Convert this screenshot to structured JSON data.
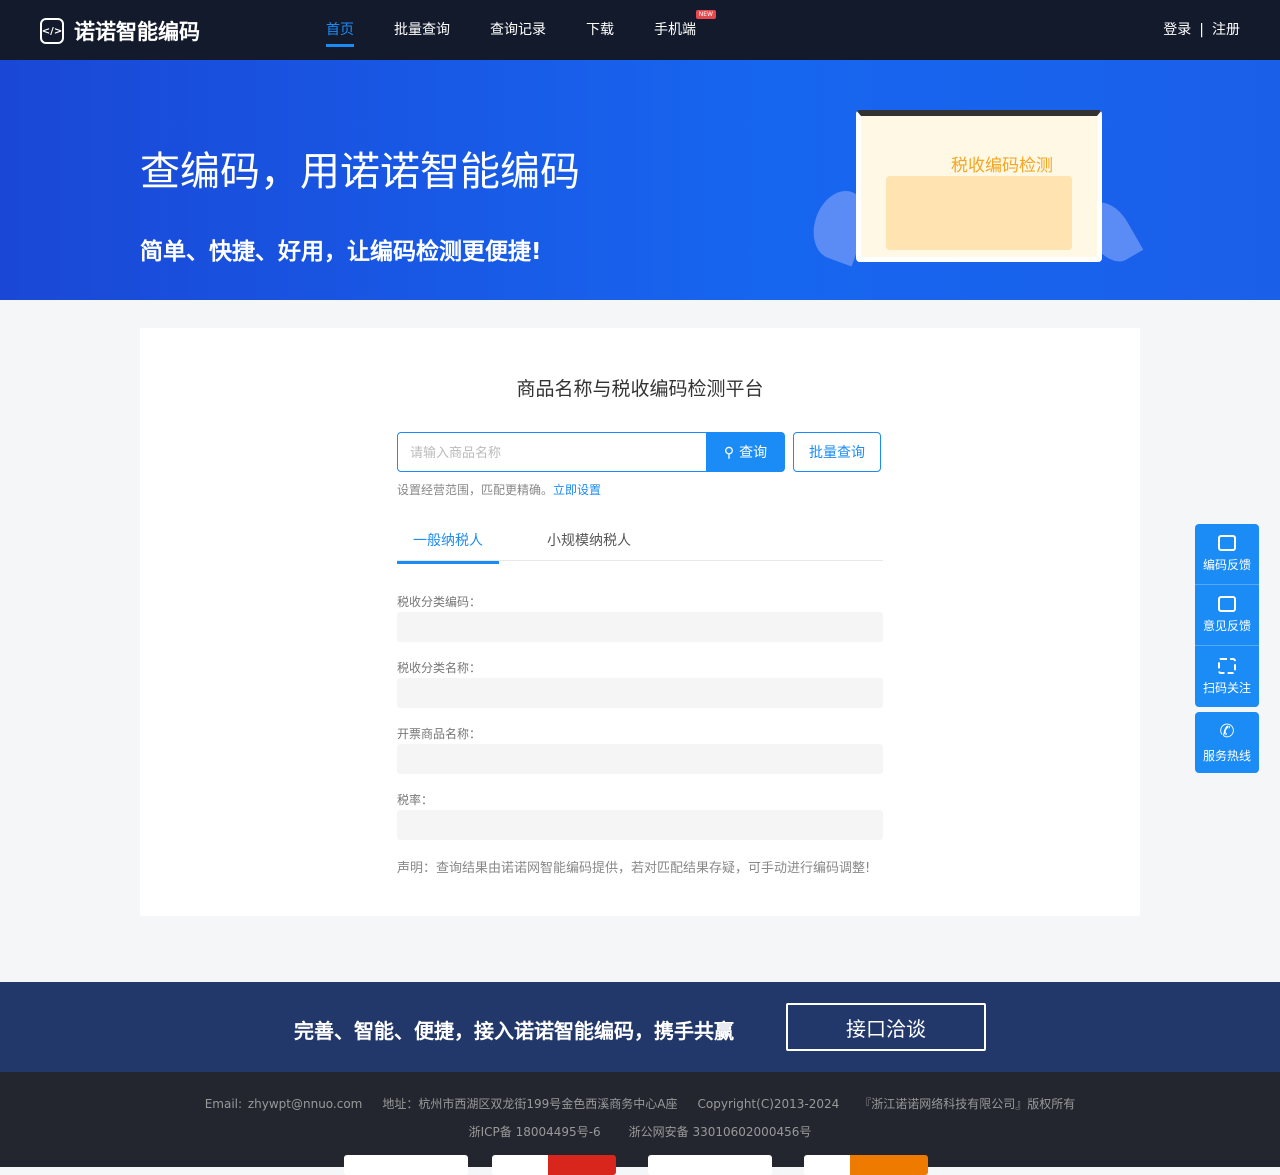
{
  "nav": {
    "logo": "诺诺智能编码",
    "items": [
      {
        "label": "首页"
      },
      {
        "label": "批量查询"
      },
      {
        "label": "查询记录"
      },
      {
        "label": "下载"
      },
      {
        "label": "手机端",
        "badge": "NEW"
      }
    ],
    "login": "登录",
    "register": "注册"
  },
  "banner": {
    "title": "查编码，用诺诺智能编码",
    "subtitle": "简单、快捷、好用，让编码检测更便捷!",
    "illustration_text": "税收编码检测"
  },
  "main": {
    "title": "商品名称与税收编码检测平台",
    "search_placeholder": "请输入商品名称",
    "search_value": "",
    "search_button": "查询",
    "batch_button": "批量查询",
    "hint": "设置经营范围，匹配更精确。",
    "hint_link": "立即设置",
    "tabs": [
      {
        "label": "一般纳税人"
      },
      {
        "label": "小规模纳税人"
      }
    ],
    "fields": [
      {
        "label": "税收分类编码：",
        "value": ""
      },
      {
        "label": "税收分类名称：",
        "value": ""
      },
      {
        "label": "开票商品名称：",
        "value": ""
      },
      {
        "label": "税率：",
        "value": ""
      }
    ],
    "declaration": "声明：查询结果由诺诺网智能编码提供，若对匹配结果存疑，可手动进行编码调整!"
  },
  "sidebar": {
    "items": [
      {
        "label": "编码反馈",
        "icon": "code-icon"
      },
      {
        "label": "意见反馈",
        "icon": "edit-icon"
      },
      {
        "label": "扫码关注",
        "icon": "qrcode-icon"
      }
    ],
    "hotline": "服务热线"
  },
  "cta": {
    "text": "完善、智能、便捷，接入诺诺智能编码，携手共赢",
    "button": "接口洽谈"
  },
  "footer": {
    "email": "Email: zhywpt@nnuo.com",
    "address": "地址：杭州市西湖区双龙街199号金色西溪商务中心A座",
    "copyright": "Copyright(C)2013-2024",
    "company": "『浙江诺诺网络科技有限公司』版权所有",
    "icp": "浙ICP备 18004495号-6",
    "police": "浙公网安备 33010602000456号"
  },
  "colors": {
    "accent": "#1b8cf6",
    "nav_bg": "#131a2b"
  }
}
